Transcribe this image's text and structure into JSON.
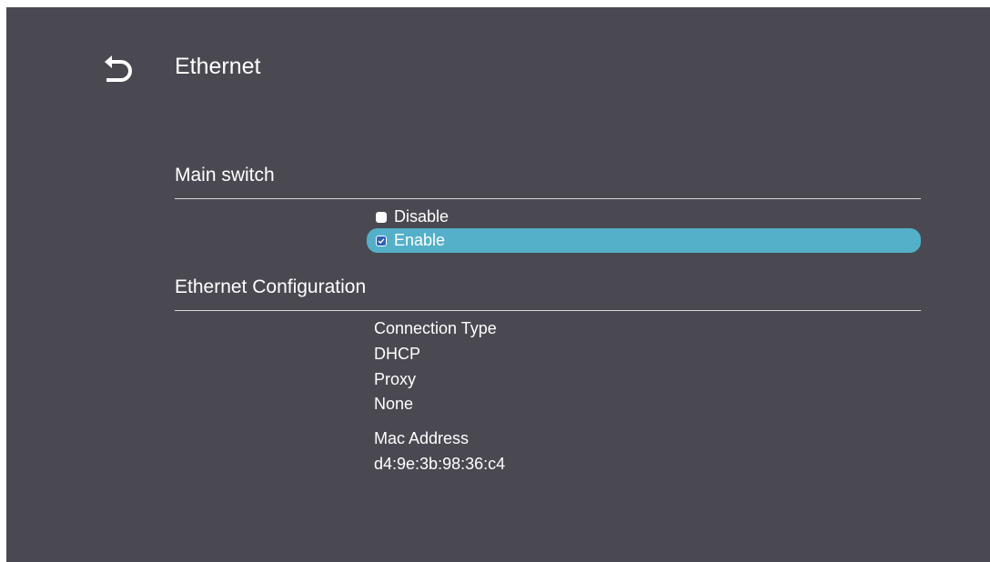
{
  "header": {
    "title": "Ethernet",
    "back_icon": "back-arrow-icon"
  },
  "main_switch": {
    "title": "Main switch",
    "options": [
      {
        "label": "Disable",
        "checked": false
      },
      {
        "label": "Enable",
        "checked": true
      }
    ]
  },
  "configuration": {
    "title": "Ethernet Configuration",
    "connection_type_label": "Connection Type",
    "connection_type_value": "DHCP",
    "proxy_label": "Proxy",
    "proxy_value": "None",
    "mac_label": "Mac Address",
    "mac_value": "d4:9e:3b:98:36:c4"
  },
  "colors": {
    "background": "#4a4952",
    "selected": "#53b0c8",
    "text": "#ffffff"
  }
}
